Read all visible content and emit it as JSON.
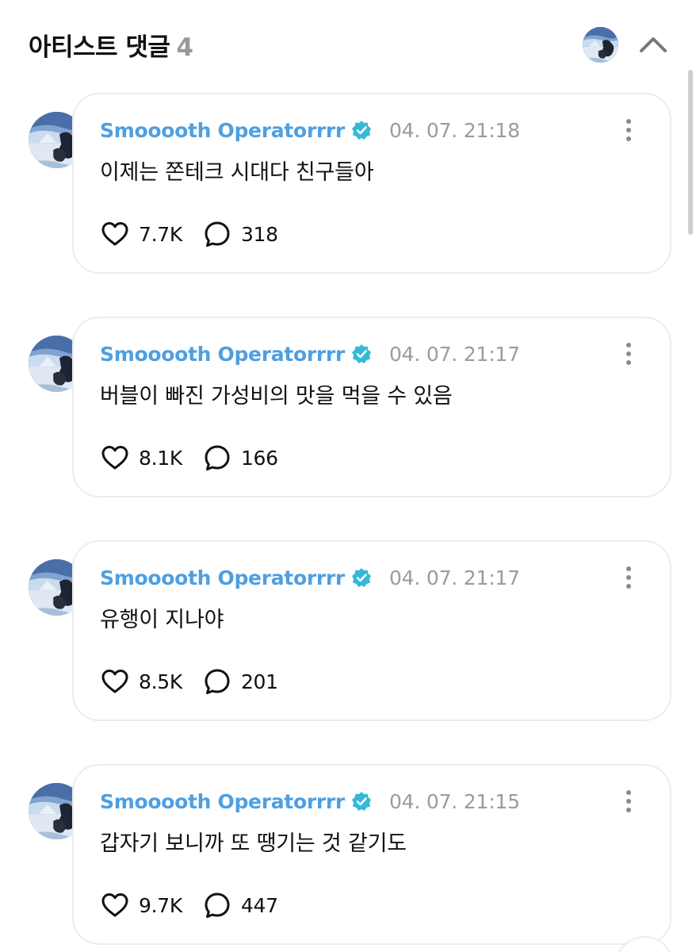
{
  "header": {
    "title": "아티스트 댓글",
    "count": "4",
    "avatar_icon": "profile-avatar-icon",
    "collapse_icon": "chevron-up-icon"
  },
  "colors": {
    "username": "#4f9fe0",
    "verified_badge": "#35b9d8",
    "timestamp": "#9b9b9b",
    "bubble_border": "#ececec"
  },
  "comments": [
    {
      "username": "Smooooth Operatorrrr",
      "timestamp": "04. 07. 21:18",
      "text": "이제는 쫀테크 시대다 친구들아",
      "likes": "7.7K",
      "replies": "318"
    },
    {
      "username": "Smooooth Operatorrrr",
      "timestamp": "04. 07. 21:17",
      "text": "버블이 빠진 가성비의 맛을 먹을 수 있음",
      "likes": "8.1K",
      "replies": "166"
    },
    {
      "username": "Smooooth Operatorrrr",
      "timestamp": "04. 07. 21:17",
      "text": "유행이 지나야",
      "likes": "8.5K",
      "replies": "201"
    },
    {
      "username": "Smooooth Operatorrrr",
      "timestamp": "04. 07. 21:15",
      "text": "갑자기 보니까 또 땡기는 것 같기도",
      "likes": "9.7K",
      "replies": "447"
    }
  ]
}
